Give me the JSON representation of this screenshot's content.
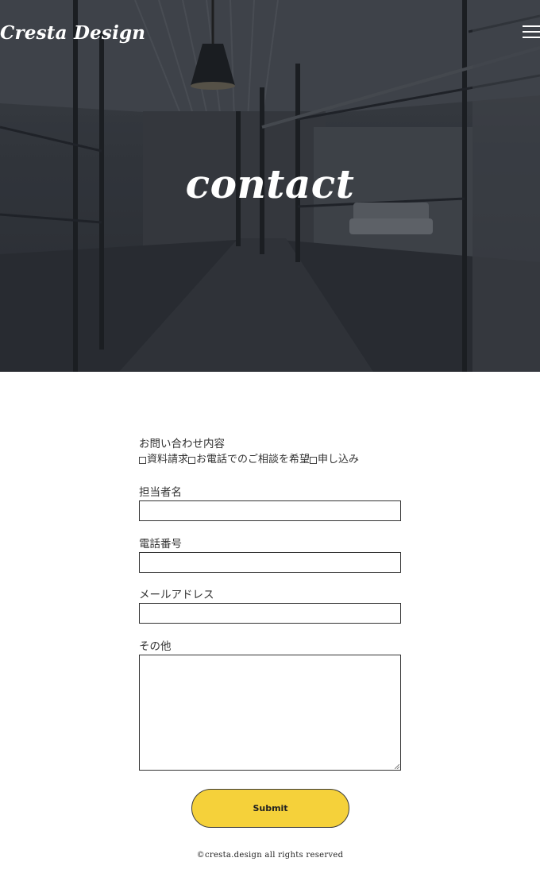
{
  "header": {
    "logo_text": "Cresta Design",
    "menu_icon": "hamburger-menu-icon"
  },
  "hero": {
    "title": "contact"
  },
  "form": {
    "inquiry": {
      "label": "お問い合わせ内容",
      "options": [
        "資料請求",
        "お電話でのご相談を希望",
        "申し込み"
      ]
    },
    "name_label": "担当者名",
    "phone_label": "電話番号",
    "email_label": "メールアドレス",
    "other_label": "その他",
    "submit_label": "Submit"
  },
  "footer": {
    "copyright": "©cresta.design all rights reserved"
  },
  "colors": {
    "accent": "#f5d13a",
    "hero_overlay": "#3b3f46"
  }
}
